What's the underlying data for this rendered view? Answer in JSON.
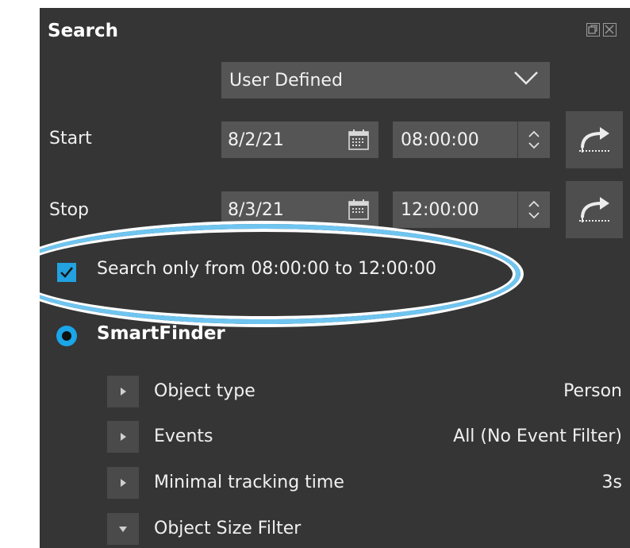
{
  "panel": {
    "title": "Search"
  },
  "range": {
    "preset": "User Defined"
  },
  "start": {
    "label": "Start",
    "date": "8/2/21",
    "time": "08:00:00"
  },
  "stop": {
    "label": "Stop",
    "date": "8/3/21",
    "time": "12:00:00"
  },
  "daily_window": {
    "checked": true,
    "label": "Search only from 08:00:00 to 12:00:00"
  },
  "smartfinder": {
    "label": "SmartFinder",
    "properties": [
      {
        "label": "Object type",
        "value": "Person",
        "expanded": false
      },
      {
        "label": "Events",
        "value": "All (No Event Filter)",
        "expanded": false
      },
      {
        "label": "Minimal tracking time",
        "value": "3s",
        "expanded": false
      },
      {
        "label": "Object Size Filter",
        "value": "",
        "expanded": true
      }
    ]
  },
  "colors": {
    "accent": "#22a2e0",
    "panel_bg": "#353535",
    "field_bg": "#555555",
    "highlight": "#6fc5f0"
  }
}
